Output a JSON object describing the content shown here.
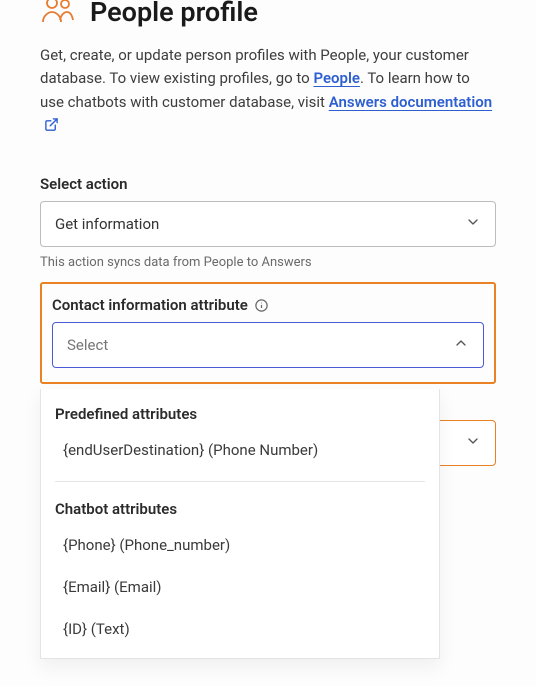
{
  "header": {
    "title": "People profile"
  },
  "description": {
    "part1": "Get, create, or update person profiles with People, your customer database. To view existing profiles, go to ",
    "link1": "People",
    "part2": ". To learn how to use chatbots with customer database, visit ",
    "link2": "Answers documentation"
  },
  "action": {
    "label": "Select action",
    "value": "Get information",
    "helper": "This action syncs data from People to Answers"
  },
  "contactAttr": {
    "label": "Contact information attribute",
    "placeholder": "Select"
  },
  "dropdown": {
    "group1": "Predefined attributes",
    "item1": "{endUserDestination} (Phone Number)",
    "group2": "Chatbot attributes",
    "item2": "{Phone} (Phone_number)",
    "item3": "{Email} (Email)",
    "item4": "{ID} (Text)"
  }
}
